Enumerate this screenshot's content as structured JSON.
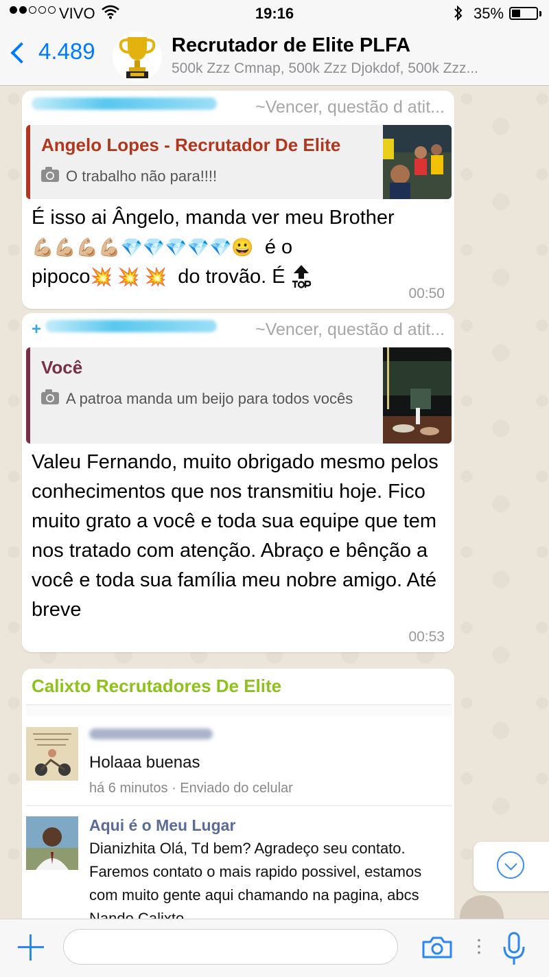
{
  "status_bar": {
    "carrier": "VIVO",
    "time": "19:16",
    "battery_pct": "35%",
    "battery_level": 0.35,
    "signal_bars_filled": 2,
    "signal_bars_total": 5
  },
  "header": {
    "back_count": "4.489",
    "title": "Recrutador de Elite PLFA",
    "subtitle": "500k Zzz Cmnap, 500k Zzz Djokdof, 500k Zzz..."
  },
  "messages": [
    {
      "push_name": "~Vencer, questão d atit...",
      "quote": {
        "author": "Angelo Lopes - Recrutador De Elite",
        "author_color": "#b0371e",
        "text": "O trabalho não para!!!!"
      },
      "lines": [
        "É isso ai Ângelo, manda ver meu Brother",
        "é o",
        "pipoco",
        "do trovão. É"
      ],
      "emoji_muscle": "💪🏼",
      "emoji_gem": "💎",
      "emoji_smile": "😀",
      "emoji_boom": "💥",
      "time": "00:50"
    },
    {
      "push_name": "~Vencer, questão d atit...",
      "quote": {
        "author": "Você",
        "author_color": "#7a2f49",
        "text": "A patroa manda um beijo para todos vocês"
      },
      "text": "Valeu Fernando, muito obrigado mesmo pelos conhecimentos que nos transmitiu hoje. Fico muito grato a você e toda sua equipe que tem nos tratado com atenção. Abraço e bênção a você e toda sua família meu nobre amigo. Até breve",
      "time": "00:53"
    },
    {
      "sender": "Calixto Recrutadores De Elite",
      "sender_color": "#8ec11b",
      "fb_post": {
        "text": "Holaaa buenas",
        "meta": "há 6 minutos · Enviado do celular"
      },
      "fb_reply": {
        "page": "Aqui é o Meu Lugar",
        "text": "Dianizhita Olá, Td bem? Agradeço seu contato. Faremos contato o mais rapido possivel, estamos com muito gente aqui chamando na pagina, abcs Nando Calixto"
      }
    }
  ],
  "input": {
    "placeholder": ""
  }
}
